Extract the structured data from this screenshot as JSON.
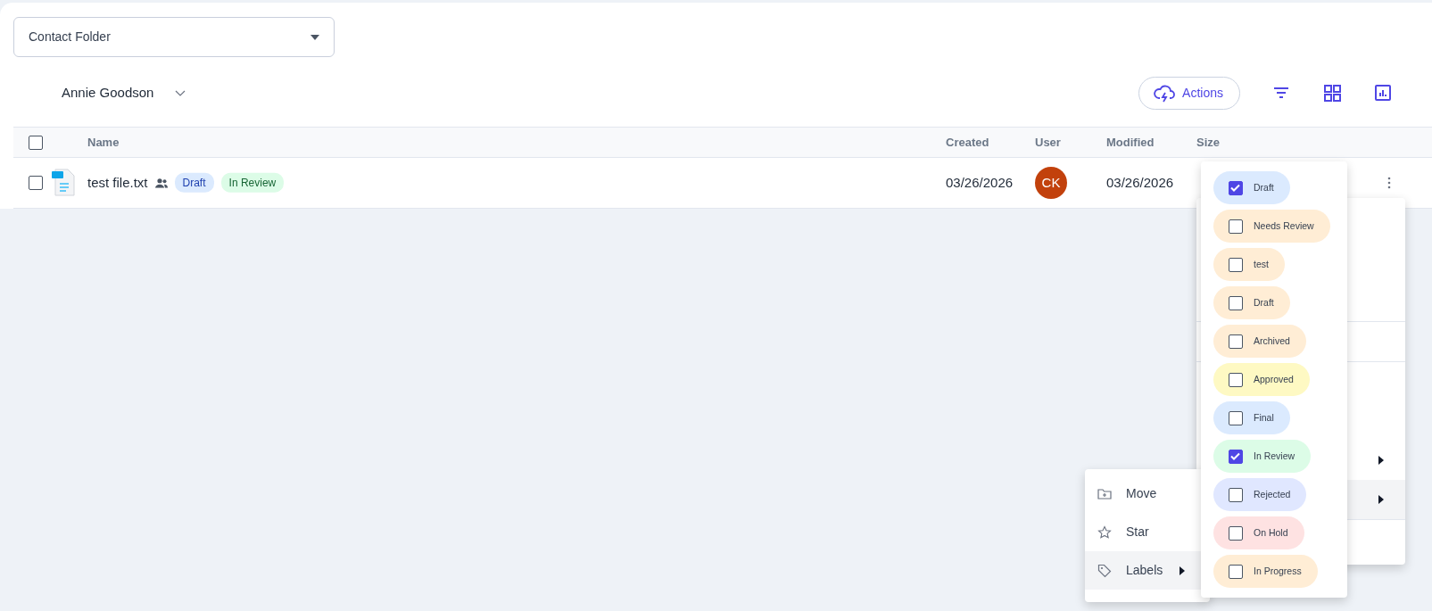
{
  "folder_select": {
    "value": "Contact Folder"
  },
  "user_filter": {
    "value": "Annie Goodson"
  },
  "toolbar": {
    "actions_label": "Actions"
  },
  "table": {
    "select_all_checked": false,
    "columns": [
      "Name",
      "Created",
      "User",
      "Modified",
      "Size"
    ],
    "rows": [
      {
        "checked": false,
        "name": "test file.txt",
        "shared": true,
        "labels": [
          {
            "text": "Draft",
            "color": "#dbeafe"
          },
          {
            "text": "In Review",
            "color": "#dcfce7"
          }
        ],
        "created": "03/26/2026",
        "user_initials": "CK",
        "modified": "03/26/2026"
      }
    ]
  },
  "row_menu": {
    "groups": [
      [
        {
          "submenu": false,
          "selected": false
        },
        {
          "submenu": false,
          "selected": false
        },
        {
          "submenu": false,
          "selected": false
        }
      ],
      [
        {
          "submenu": false,
          "selected": false
        }
      ],
      [
        {
          "submenu": false,
          "selected": false
        },
        {
          "submenu": false,
          "selected": false
        },
        {
          "submenu": true,
          "selected": false
        },
        {
          "submenu": true,
          "selected": true
        }
      ],
      [
        {
          "submenu": false,
          "selected": false
        }
      ]
    ]
  },
  "context_menu": {
    "items": [
      {
        "kind": "move",
        "label": "Move",
        "submenu": false,
        "selected": false
      },
      {
        "kind": "star",
        "label": "Star",
        "submenu": false,
        "selected": false
      },
      {
        "kind": "labels",
        "label": "Labels",
        "submenu": true,
        "selected": true
      }
    ]
  },
  "labels_menu": {
    "items": [
      {
        "text": "Draft",
        "color": "#dbeafe",
        "checked": true
      },
      {
        "text": "Needs Review",
        "color": "#ffedd5",
        "checked": false
      },
      {
        "text": "test",
        "color": "#ffedd5",
        "checked": false
      },
      {
        "text": "Draft",
        "color": "#ffedd5",
        "checked": false
      },
      {
        "text": "Archived",
        "color": "#ffedd5",
        "checked": false
      },
      {
        "text": "Approved",
        "color": "#fef9c3",
        "checked": false
      },
      {
        "text": "Final",
        "color": "#dbeafe",
        "checked": false
      },
      {
        "text": "In Review",
        "color": "#dcfce7",
        "checked": true
      },
      {
        "text": "Rejected",
        "color": "#e0e7ff",
        "checked": false
      },
      {
        "text": "On Hold",
        "color": "#fee2e2",
        "checked": false
      },
      {
        "text": "In Progress",
        "color": "#ffedd5",
        "checked": false
      }
    ]
  }
}
